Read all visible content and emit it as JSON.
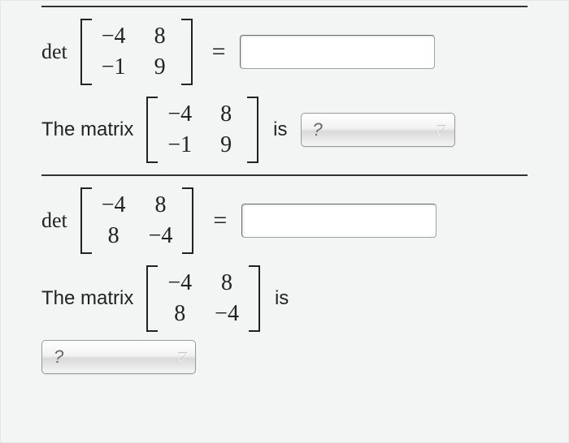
{
  "problems": [
    {
      "det_label": "det",
      "matrix": {
        "a11": "−4",
        "a12": "8",
        "a21": "−1",
        "a22": "9"
      },
      "equals": "=",
      "det_answer": "",
      "classify_pre": "The matrix",
      "classify_post": "is",
      "dropdown_placeholder": "?",
      "dropdown_value": ""
    },
    {
      "det_label": "det",
      "matrix": {
        "a11": "−4",
        "a12": "8",
        "a21": "8",
        "a22": "−4"
      },
      "equals": "=",
      "det_answer": "",
      "classify_pre": "The matrix",
      "classify_post": "is",
      "dropdown_placeholder": "?",
      "dropdown_value": ""
    }
  ]
}
